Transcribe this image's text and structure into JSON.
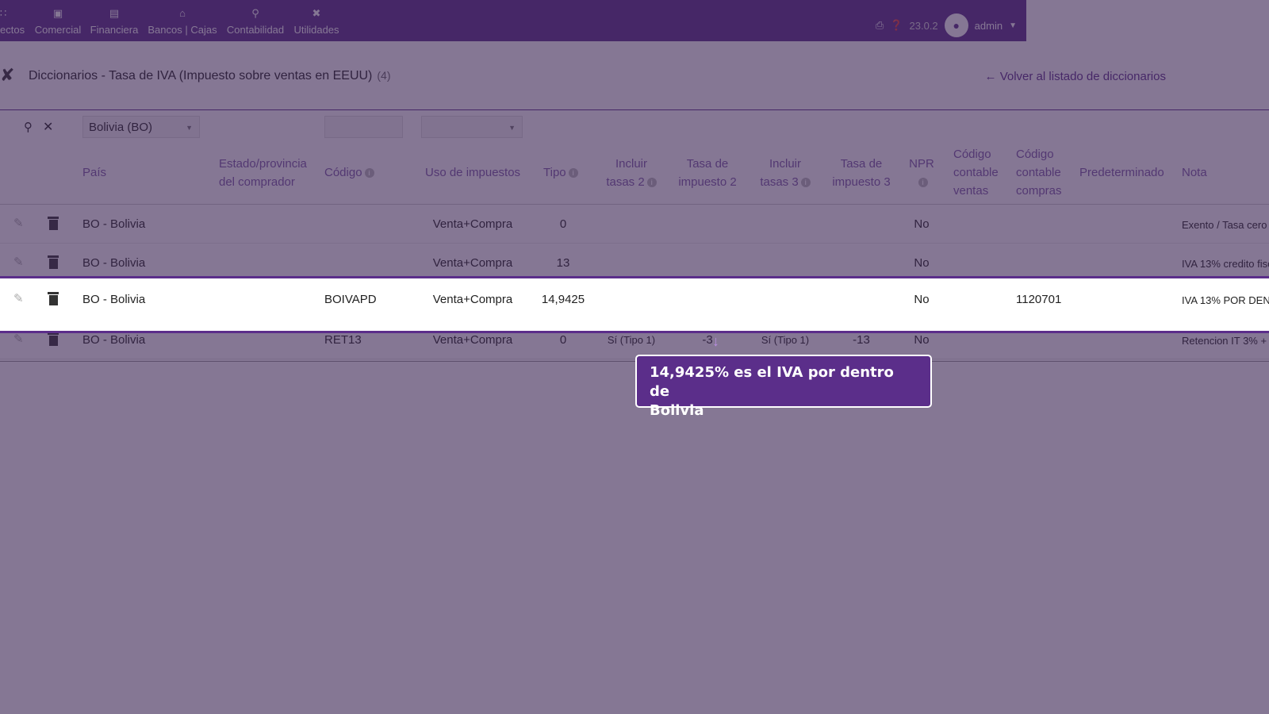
{
  "topbar": {
    "nav": [
      {
        "label": "ectos",
        "icon": "projects-icon"
      },
      {
        "label": "Comercial",
        "icon": "briefcase-icon"
      },
      {
        "label": "Financiera",
        "icon": "document-icon"
      },
      {
        "label": "Bancos | Cajas",
        "icon": "bank-icon"
      },
      {
        "label": "Contabilidad",
        "icon": "search-icon"
      },
      {
        "label": "Utilidades",
        "icon": "wrench-icon"
      }
    ],
    "version": "23.0.2",
    "user": "admin"
  },
  "page": {
    "title": "Diccionarios - Tasa de IVA (Impuesto sobre ventas en EEUU)",
    "count": "(4)",
    "back_link": "Volver al listado de diccionarios"
  },
  "filters": {
    "country": "Bolivia (BO)"
  },
  "columns": {
    "pais": "País",
    "estado_1": "Estado/provincia",
    "estado_2": "del comprador",
    "codigo": "Código",
    "uso": "Uso de impuestos",
    "tipo": "Tipo",
    "incluir2_1": "Incluir",
    "incluir2_2": "tasas 2",
    "tasa2_1": "Tasa de",
    "tasa2_2": "impuesto 2",
    "incluir3_1": "Incluir",
    "incluir3_2": "tasas 3",
    "tasa3_1": "Tasa de",
    "tasa3_2": "impuesto 3",
    "npr": "NPR",
    "ccv_1": "Código",
    "ccv_2": "contable",
    "ccv_3": "ventas",
    "ccc_1": "Código",
    "ccc_2": "contable",
    "ccc_3": "compras",
    "predeterminado": "Predeterminado",
    "nota": "Nota"
  },
  "rows": [
    {
      "pais": "BO - Bolivia",
      "codigo": "",
      "uso": "Venta+Compra",
      "tipo": "0",
      "incluir2": "",
      "tasa2": "",
      "incluir3": "",
      "tasa3": "",
      "npr": "No",
      "ccv": "",
      "ccc": "",
      "nota": "Exento / Tasa cero"
    },
    {
      "pais": "BO - Bolivia",
      "codigo": "",
      "uso": "Venta+Compra",
      "tipo": "13",
      "incluir2": "",
      "tasa2": "",
      "incluir3": "",
      "tasa3": "",
      "npr": "No",
      "ccv": "",
      "ccc": "",
      "nota": "IVA 13% credito fisc"
    },
    {
      "pais": "BO - Bolivia",
      "codigo": "BOIVAPD",
      "uso": "Venta+Compra",
      "tipo": "14,9425",
      "incluir2": "",
      "tasa2": "",
      "incluir3": "",
      "tasa3": "",
      "npr": "No",
      "ccv": "",
      "ccc": "1120701",
      "nota": "IVA 13% POR DEN"
    },
    {
      "pais": "BO - Bolivia",
      "codigo": "RET13",
      "uso": "Venta+Compra",
      "tipo": "0",
      "incluir2": "Sí (Tipo 1)",
      "tasa2": "-3",
      "incluir3": "Sí (Tipo 1)",
      "tasa3": "-13",
      "npr": "No",
      "ccv": "",
      "ccc": "",
      "nota": "Retencion IT 3% + I"
    }
  ],
  "tooltip": {
    "line1": "14,9425% es el IVA por dentro de",
    "line2": "Bolivia"
  }
}
